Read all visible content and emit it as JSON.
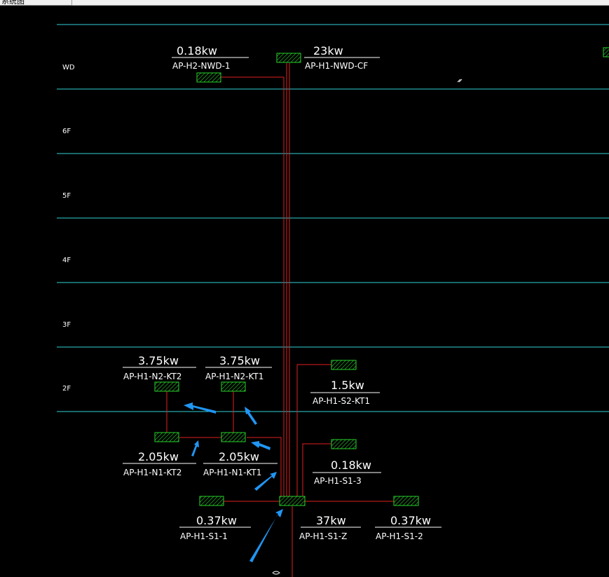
{
  "window": {
    "tab_label": "系统图"
  },
  "floors": [
    "WD",
    "6F",
    "5F",
    "4F",
    "3F",
    "2F"
  ],
  "panels": {
    "wd_left": {
      "power": "0.18kw",
      "name": "AP-H2-NWD-1"
    },
    "wd_right": {
      "power": "23kw",
      "name": "AP-H1-NWD-CF"
    },
    "kt2_upper": {
      "power": "3.75kw",
      "name": "AP-H1-N2-KT2"
    },
    "kt1_upper": {
      "power": "3.75kw",
      "name": "AP-H1-N2-KT1"
    },
    "s2_kt1": {
      "power": "1.5kw",
      "name": "AP-H1-S2-KT1"
    },
    "kt2_lower": {
      "power": "2.05kw",
      "name": "AP-H1-N1-KT2"
    },
    "kt1_lower": {
      "power": "2.05kw",
      "name": "AP-H1-N1-KT1"
    },
    "s1_3": {
      "power": "0.18kw",
      "name": "AP-H1-S1-3"
    },
    "s1_1": {
      "power": "0.37kw",
      "name": "AP-H1-S1-1"
    },
    "s1_z": {
      "power": "37kw",
      "name": "AP-H1-S1-Z"
    },
    "s1_2": {
      "power": "0.37kw",
      "name": "AP-H1-S1-2"
    }
  },
  "colors": {
    "background": "#000000",
    "floor_line": "#2fd0d6",
    "wire": "#e02020",
    "panel": "#27d42a",
    "text": "#ffffff",
    "arrow": "#2196f3"
  }
}
